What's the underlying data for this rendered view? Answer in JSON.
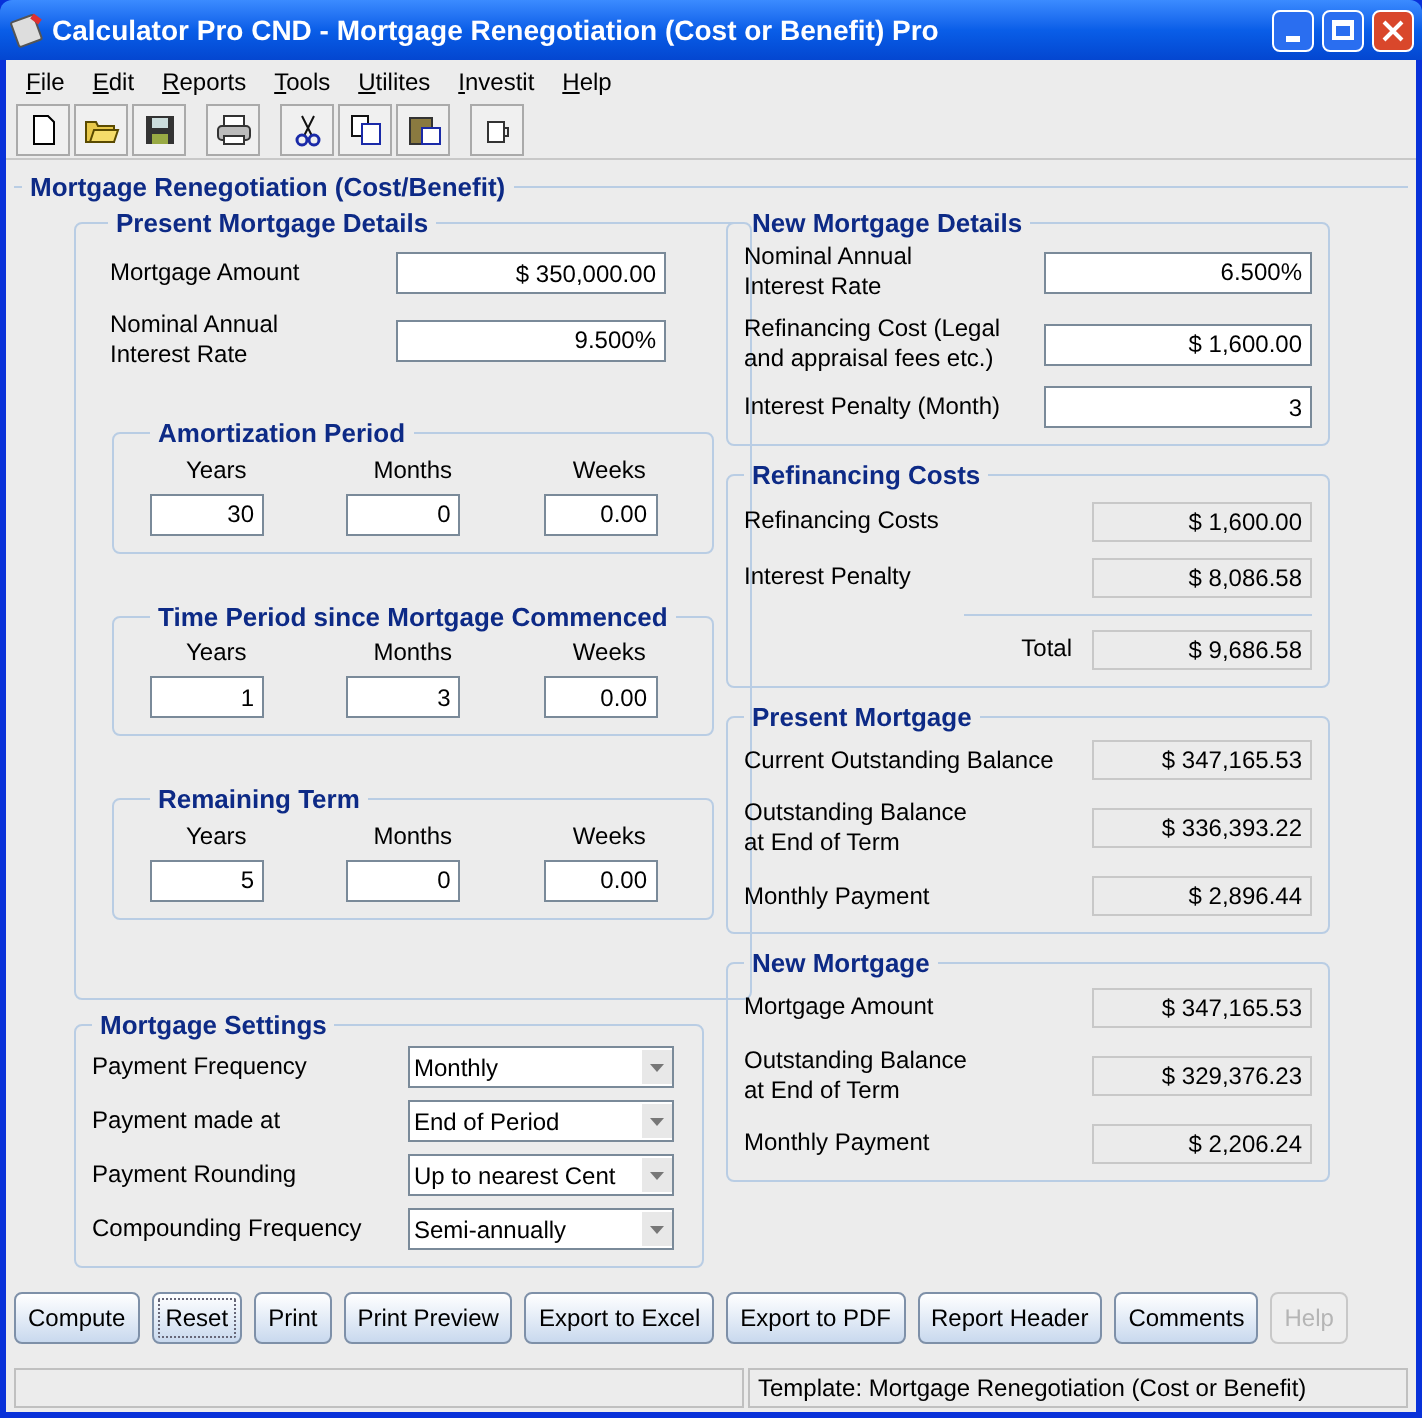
{
  "window": {
    "title": "Calculator Pro CND - Mortgage Renegotiation (Cost or Benefit) Pro"
  },
  "menu": [
    "File",
    "Edit",
    "Reports",
    "Tools",
    "Utilites",
    "Investit",
    "Help"
  ],
  "toolbar": [
    [
      {
        "kind": "new"
      },
      {
        "kind": "open"
      },
      {
        "kind": "save"
      }
    ],
    [
      {
        "kind": "print"
      }
    ],
    [
      {
        "kind": "cut"
      },
      {
        "kind": "copy"
      },
      {
        "kind": "paste"
      }
    ],
    [
      {
        "kind": "cup"
      }
    ]
  ],
  "panel": {
    "title": "Mortgage Renegotiation (Cost/Benefit)"
  },
  "present_details": {
    "title": "Present Mortgage Details",
    "fields": [
      {
        "label": "Mortgage Amount",
        "value": "$ 350,000.00"
      },
      {
        "label": "Nominal Annual Interest Rate",
        "value": "9.500%"
      }
    ],
    "periods": [
      {
        "title": "Amortization Period",
        "columns": [
          "Years",
          "Months",
          "Weeks"
        ],
        "values": [
          "30",
          "0",
          "0.00"
        ]
      },
      {
        "title": "Time Period since Mortgage Commenced",
        "columns": [
          "Years",
          "Months",
          "Weeks"
        ],
        "values": [
          "1",
          "3",
          "0.00"
        ]
      },
      {
        "title": "Remaining Term",
        "columns": [
          "Years",
          "Months",
          "Weeks"
        ],
        "values": [
          "5",
          "0",
          "0.00"
        ]
      }
    ]
  },
  "settings": {
    "title": "Mortgage Settings",
    "rows": [
      {
        "label": "Payment Frequency",
        "value": "Monthly"
      },
      {
        "label": "Payment made at",
        "value": "End of Period"
      },
      {
        "label": "Payment Rounding",
        "value": "Up to nearest Cent"
      },
      {
        "label": "Compounding Frequency",
        "value": "Semi-annually"
      }
    ]
  },
  "new_details": {
    "title": "New Mortgage Details",
    "fields": [
      {
        "label": "Nominal Annual Interest Rate",
        "value": "6.500%"
      },
      {
        "label": "Refinancing Cost (Legal and appraisal fees etc.)",
        "value": "$ 1,600.00"
      },
      {
        "label": "Interest Penalty (Month)",
        "value": "3"
      }
    ]
  },
  "refinancing": {
    "title": "Refinancing Costs",
    "rows": [
      {
        "label": "Refinancing Costs",
        "value": "$ 1,600.00"
      },
      {
        "label": "Interest Penalty",
        "value": "$ 8,086.58"
      }
    ],
    "total": {
      "label": "Total",
      "value": "$ 9,686.58"
    }
  },
  "present_mortgage": {
    "title": "Present Mortgage",
    "rows": [
      {
        "label": "Current Outstanding Balance",
        "value": "$ 347,165.53"
      },
      {
        "label": "Outstanding Balance at End of Term",
        "value": "$ 336,393.22"
      },
      {
        "label": "Monthly Payment",
        "value": "$ 2,896.44"
      }
    ]
  },
  "new_mortgage": {
    "title": "New Mortgage",
    "rows": [
      {
        "label": "Mortgage Amount",
        "value": "$ 347,165.53"
      },
      {
        "label": "Outstanding Balance at End of Term",
        "value": "$ 329,376.23"
      },
      {
        "label": "Monthly Payment",
        "value": "$ 2,206.24"
      }
    ]
  },
  "buttons": [
    {
      "label": "Compute",
      "disabled": false,
      "focused": false
    },
    {
      "label": "Reset",
      "disabled": false,
      "focused": true
    },
    {
      "label": "Print",
      "disabled": false,
      "focused": false
    },
    {
      "label": "Print Preview",
      "disabled": false,
      "focused": false
    },
    {
      "label": "Export to Excel",
      "disabled": false,
      "focused": false
    },
    {
      "label": "Export to PDF",
      "disabled": false,
      "focused": false
    },
    {
      "label": "Report Header",
      "disabled": false,
      "focused": false
    },
    {
      "label": "Comments",
      "disabled": false,
      "focused": false
    },
    {
      "label": "Help",
      "disabled": true,
      "focused": false
    }
  ],
  "status_bar": {
    "text": "Template: Mortgage Renegotiation (Cost or Benefit)"
  }
}
